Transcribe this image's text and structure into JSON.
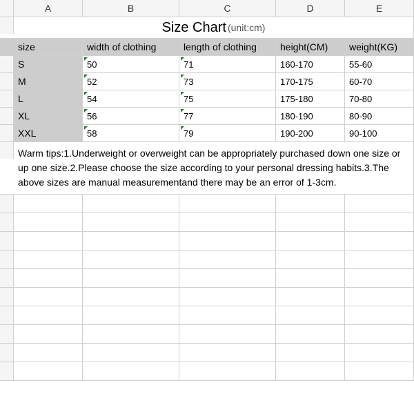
{
  "columns": [
    "A",
    "B",
    "C",
    "D",
    "E"
  ],
  "title": "Size Chart",
  "title_unit": "(unit:cm)",
  "headers": {
    "size": "size",
    "width": "width of clothing",
    "length": "length of clothing",
    "height": "height(CM)",
    "weight": "weight(KG)"
  },
  "rows": [
    {
      "size": "S",
      "width": "50",
      "length": "71",
      "height": "160-170",
      "weight": "55-60"
    },
    {
      "size": "M",
      "width": "52",
      "length": "73",
      "height": "170-175",
      "weight": "60-70"
    },
    {
      "size": "L",
      "width": "54",
      "length": "75",
      "height": "175-180",
      "weight": "70-80"
    },
    {
      "size": "XL",
      "width": "56",
      "length": "77",
      "height": "180-190",
      "weight": "80-90"
    },
    {
      "size": "XXL",
      "width": "58",
      "length": "79",
      "height": "190-200",
      "weight": "90-100"
    }
  ],
  "tips": "Warm tips:1.Underweight or overweight can be appropriately purchased down one size or up one size.2.Please choose the size according to your personal dressing habits.3.The above sizes are manual measurementand there may be an error of 1-3cm."
}
